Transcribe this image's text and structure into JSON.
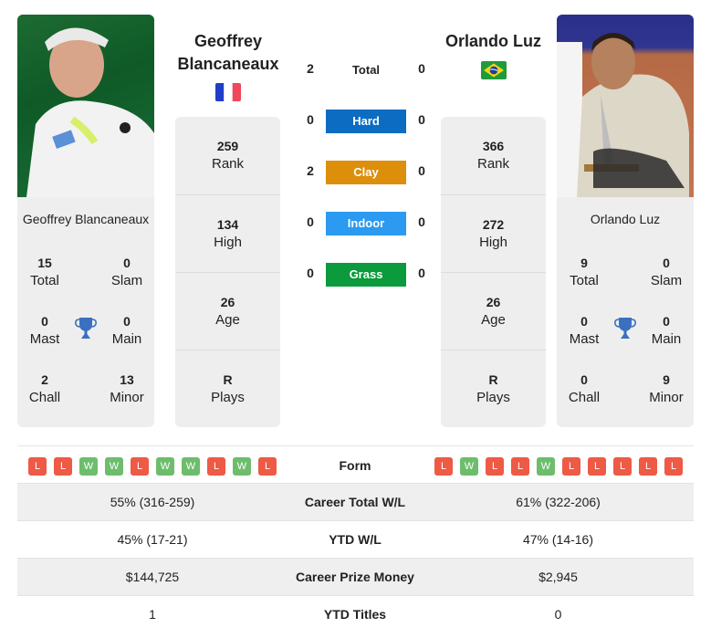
{
  "player1": {
    "name_line1": "Geoffrey",
    "name_line2": "Blancaneaux",
    "full_name": "Geoffrey Blancaneaux",
    "flag": "france-flag",
    "titles": {
      "total": {
        "value": "15",
        "label": "Total"
      },
      "slam": {
        "value": "0",
        "label": "Slam"
      },
      "mast": {
        "value": "0",
        "label": "Mast"
      },
      "main": {
        "value": "0",
        "label": "Main"
      },
      "chall": {
        "value": "2",
        "label": "Chall"
      },
      "minor": {
        "value": "13",
        "label": "Minor"
      }
    },
    "stats": [
      {
        "value": "259",
        "label": "Rank"
      },
      {
        "value": "134",
        "label": "High"
      },
      {
        "value": "26",
        "label": "Age"
      },
      {
        "value": "R",
        "label": "Plays"
      }
    ],
    "form": [
      "L",
      "L",
      "W",
      "W",
      "L",
      "W",
      "W",
      "L",
      "W",
      "L"
    ]
  },
  "player2": {
    "name": "Orlando Luz",
    "full_name": "Orlando Luz",
    "flag": "brazil-flag",
    "titles": {
      "total": {
        "value": "9",
        "label": "Total"
      },
      "slam": {
        "value": "0",
        "label": "Slam"
      },
      "mast": {
        "value": "0",
        "label": "Mast"
      },
      "main": {
        "value": "0",
        "label": "Main"
      },
      "chall": {
        "value": "0",
        "label": "Chall"
      },
      "minor": {
        "value": "9",
        "label": "Minor"
      }
    },
    "stats": [
      {
        "value": "366",
        "label": "Rank"
      },
      {
        "value": "272",
        "label": "High"
      },
      {
        "value": "26",
        "label": "Age"
      },
      {
        "value": "R",
        "label": "Plays"
      }
    ],
    "form": [
      "L",
      "W",
      "L",
      "L",
      "W",
      "L",
      "L",
      "L",
      "L",
      "L"
    ]
  },
  "h2h": {
    "total": {
      "label": "Total",
      "p1": "2",
      "p2": "0"
    },
    "surfaces": [
      {
        "label": "Hard",
        "p1": "0",
        "p2": "0",
        "color": "#0b6cc2"
      },
      {
        "label": "Clay",
        "p1": "2",
        "p2": "0",
        "color": "#dd8e0b"
      },
      {
        "label": "Indoor",
        "p1": "0",
        "p2": "0",
        "color": "#2b9af0"
      },
      {
        "label": "Grass",
        "p1": "0",
        "p2": "0",
        "color": "#0b9a3c"
      }
    ]
  },
  "comparison": {
    "form_label": "Form",
    "rows": [
      {
        "label": "Career Total W/L",
        "p1": "55% (316-259)",
        "p2": "61% (322-206)"
      },
      {
        "label": "YTD W/L",
        "p1": "45% (17-21)",
        "p2": "47% (14-16)"
      },
      {
        "label": "Career Prize Money",
        "p1": "$144,725",
        "p2": "$2,945"
      },
      {
        "label": "YTD Titles",
        "p1": "1",
        "p2": "0"
      }
    ]
  }
}
